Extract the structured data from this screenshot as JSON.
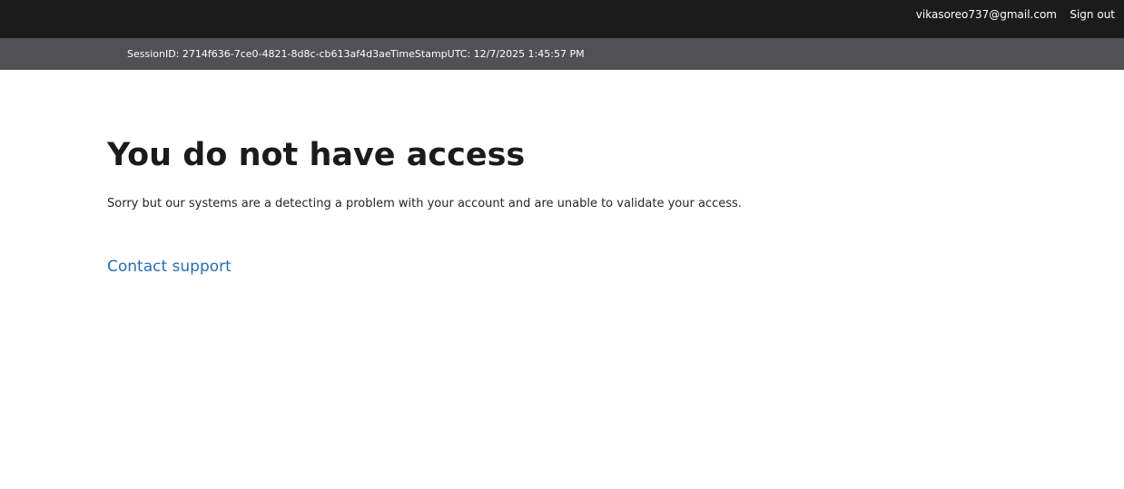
{
  "header": {
    "user_email": "vikasoreo737@gmail.com",
    "sign_out_label": "Sign out"
  },
  "session_bar": {
    "session_id": "SessionID: 2714f636-7ce0-4821-8d8c-cb613af4d3ae",
    "timestamp": "TimeStampUTC: 12/7/2025 1:45:57 PM"
  },
  "main": {
    "title": "You do not have access",
    "message": "Sorry but our systems are a detecting a problem with your account and are unable to validate your access.",
    "support_link": "Contact support"
  },
  "colors": {
    "topbar_bg": "#1b1b1b",
    "infobar_bg": "#505055",
    "link": "#2b6cb0",
    "text": "#1b1b1b"
  }
}
